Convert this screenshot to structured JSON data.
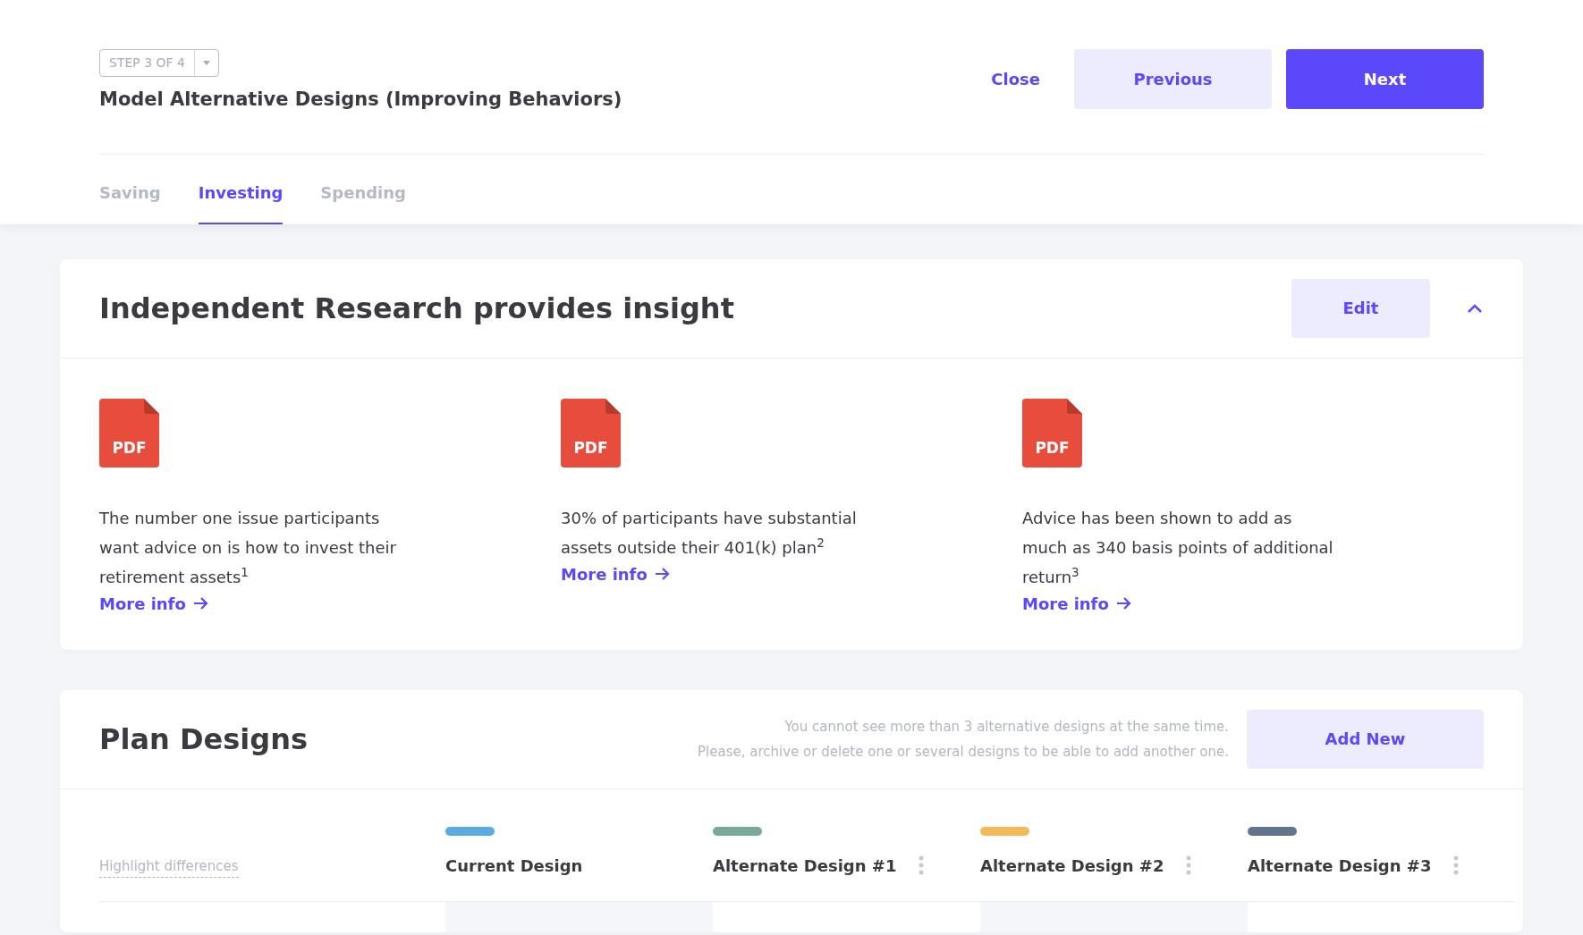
{
  "header": {
    "step": "STEP 3 OF 4",
    "title": "Model Alternative Designs (Improving Behaviors)",
    "buttons": [
      {
        "label": "Close",
        "kind": "link"
      },
      {
        "label": "Previous",
        "kind": "secondary"
      },
      {
        "label": "Next",
        "kind": "primary"
      }
    ],
    "tabs": [
      {
        "label": "Saving",
        "selected": false
      },
      {
        "label": "Investing",
        "selected": true
      },
      {
        "label": "Spending",
        "selected": false
      }
    ]
  },
  "research": {
    "title": "Independent Research provides insight",
    "edit": "Edit",
    "expanded": true,
    "items": [
      {
        "icon_text": "PDF",
        "text": "The number one issue participants want advice on is how to invest their retirement assets$^{1}$",
        "link": "More info"
      },
      {
        "icon_text": "PDF",
        "text": "30% of participants have substantial assets outside their 401(k) plan$^{2}$",
        "link": "More info"
      },
      {
        "icon_text": "PDF",
        "text": "Advice has been shown to add as much as 340 basis points of additional return$^{3}$",
        "link": "More info"
      }
    ]
  },
  "plan_designs": {
    "title": "Plan Designs",
    "note": [
      "You cannot  see more than 3 alternative designs at the same time.",
      "Please, archive or delete one or several designs to be able to add another one."
    ],
    "add": "Add New",
    "highlight": "Highlight differences",
    "designs": [
      {
        "name": "Current Design",
        "color": "#5aabe3",
        "menu": false
      },
      {
        "name": "Alternate Design #1",
        "color": "#78aa9c",
        "menu": true
      },
      {
        "name": "Alternate Design #2",
        "color": "#f5b956",
        "menu": true
      },
      {
        "name": "Alternate Design #3",
        "color": "#627590",
        "menu": true
      }
    ]
  }
}
